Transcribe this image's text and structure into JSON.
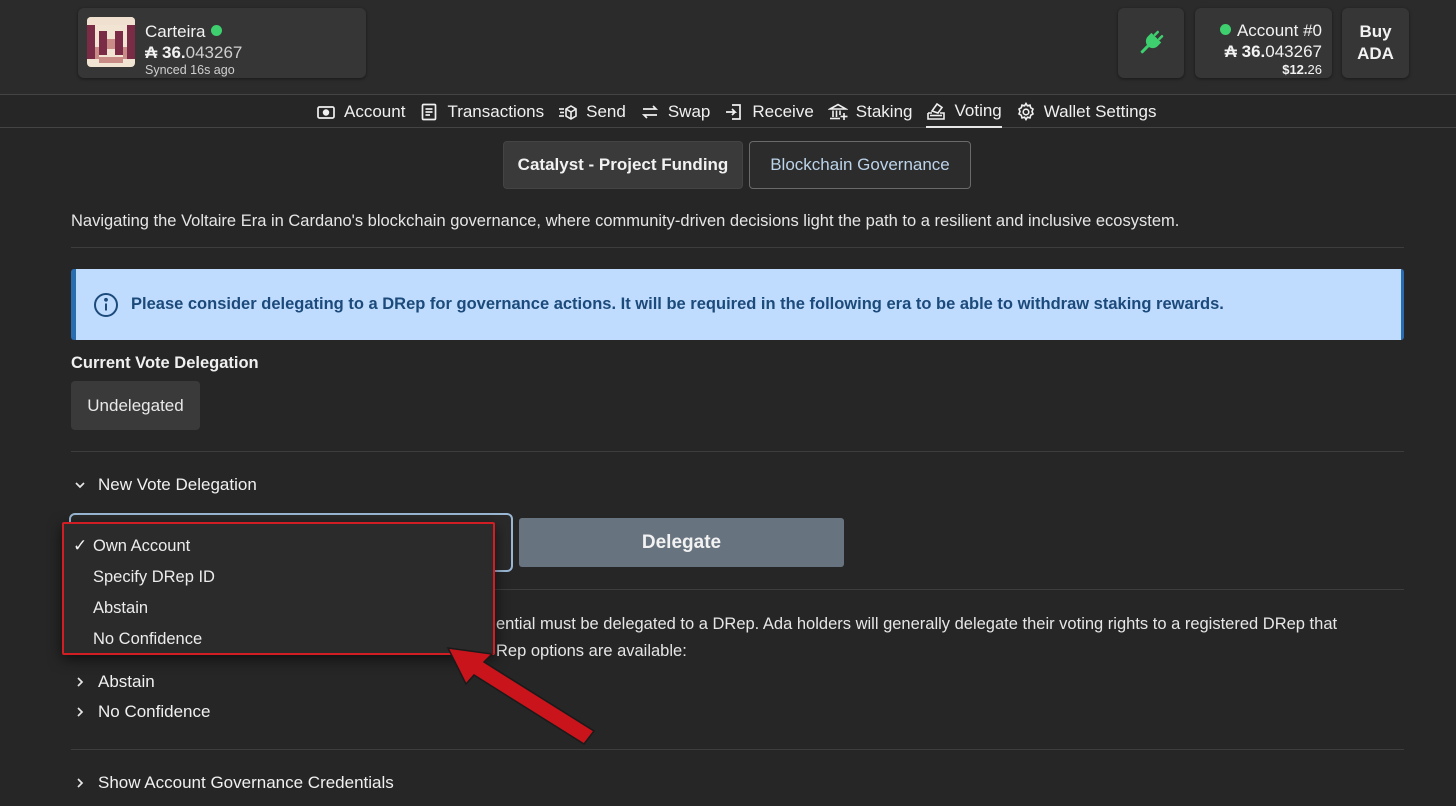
{
  "header": {
    "wallet_name": "Carteira",
    "wallet_balance_int": "₳ 36.",
    "wallet_balance_frac": "043267",
    "synced": "Synced 16s ago",
    "account_name": "Account #0",
    "account_balance_int": "₳ 36.",
    "account_balance_frac": "043267",
    "account_usd_int": "$12.",
    "account_usd_frac": "26",
    "buy_line1": "Buy",
    "buy_line2": "ADA"
  },
  "nav": {
    "items": [
      {
        "label": "Account",
        "icon": "wallet-icon"
      },
      {
        "label": "Transactions",
        "icon": "document-icon"
      },
      {
        "label": "Send",
        "icon": "send-box-icon"
      },
      {
        "label": "Swap",
        "icon": "swap-arrows-icon"
      },
      {
        "label": "Receive",
        "icon": "receive-icon"
      },
      {
        "label": "Staking",
        "icon": "bank-icon"
      },
      {
        "label": "Voting",
        "icon": "ballot-icon"
      },
      {
        "label": "Wallet Settings",
        "icon": "gear-icon"
      }
    ],
    "active": "Voting"
  },
  "tabs": {
    "catalyst": "Catalyst - Project Funding",
    "governance": "Blockchain Governance"
  },
  "content": {
    "intro": "Navigating the Voltaire Era in Cardano's blockchain governance, where community-driven decisions light the path to a resilient and inclusive ecosystem.",
    "notice": "Please consider delegating to a DRep for governance actions. It will be required in the following era to be able to withdraw staking rewards.",
    "current_label": "Current Vote Delegation",
    "current_value": "Undelegated",
    "new_delegation": "New Vote Delegation",
    "delegate_button": "Delegate",
    "body_line1": "ential must be delegated to a DRep. Ada holders will generally delegate their voting rights to a registered DRep that",
    "body_line2": "Rep options are available:",
    "abstain": "Abstain",
    "no_confidence": "No Confidence",
    "show_credentials": "Show Account Governance Credentials"
  },
  "dropdown": {
    "selected": "Own Account",
    "check": "✓",
    "options": [
      "Own Account",
      "Specify DRep ID",
      "Abstain",
      "No Confidence"
    ]
  },
  "colors": {
    "background": "#262626",
    "card": "#363636",
    "online": "#3ecf6e",
    "notice_bg": "#bfdcff",
    "notice_text": "#1c4a7a",
    "highlight": "#d01e24",
    "delegate_btn": "#687380"
  }
}
